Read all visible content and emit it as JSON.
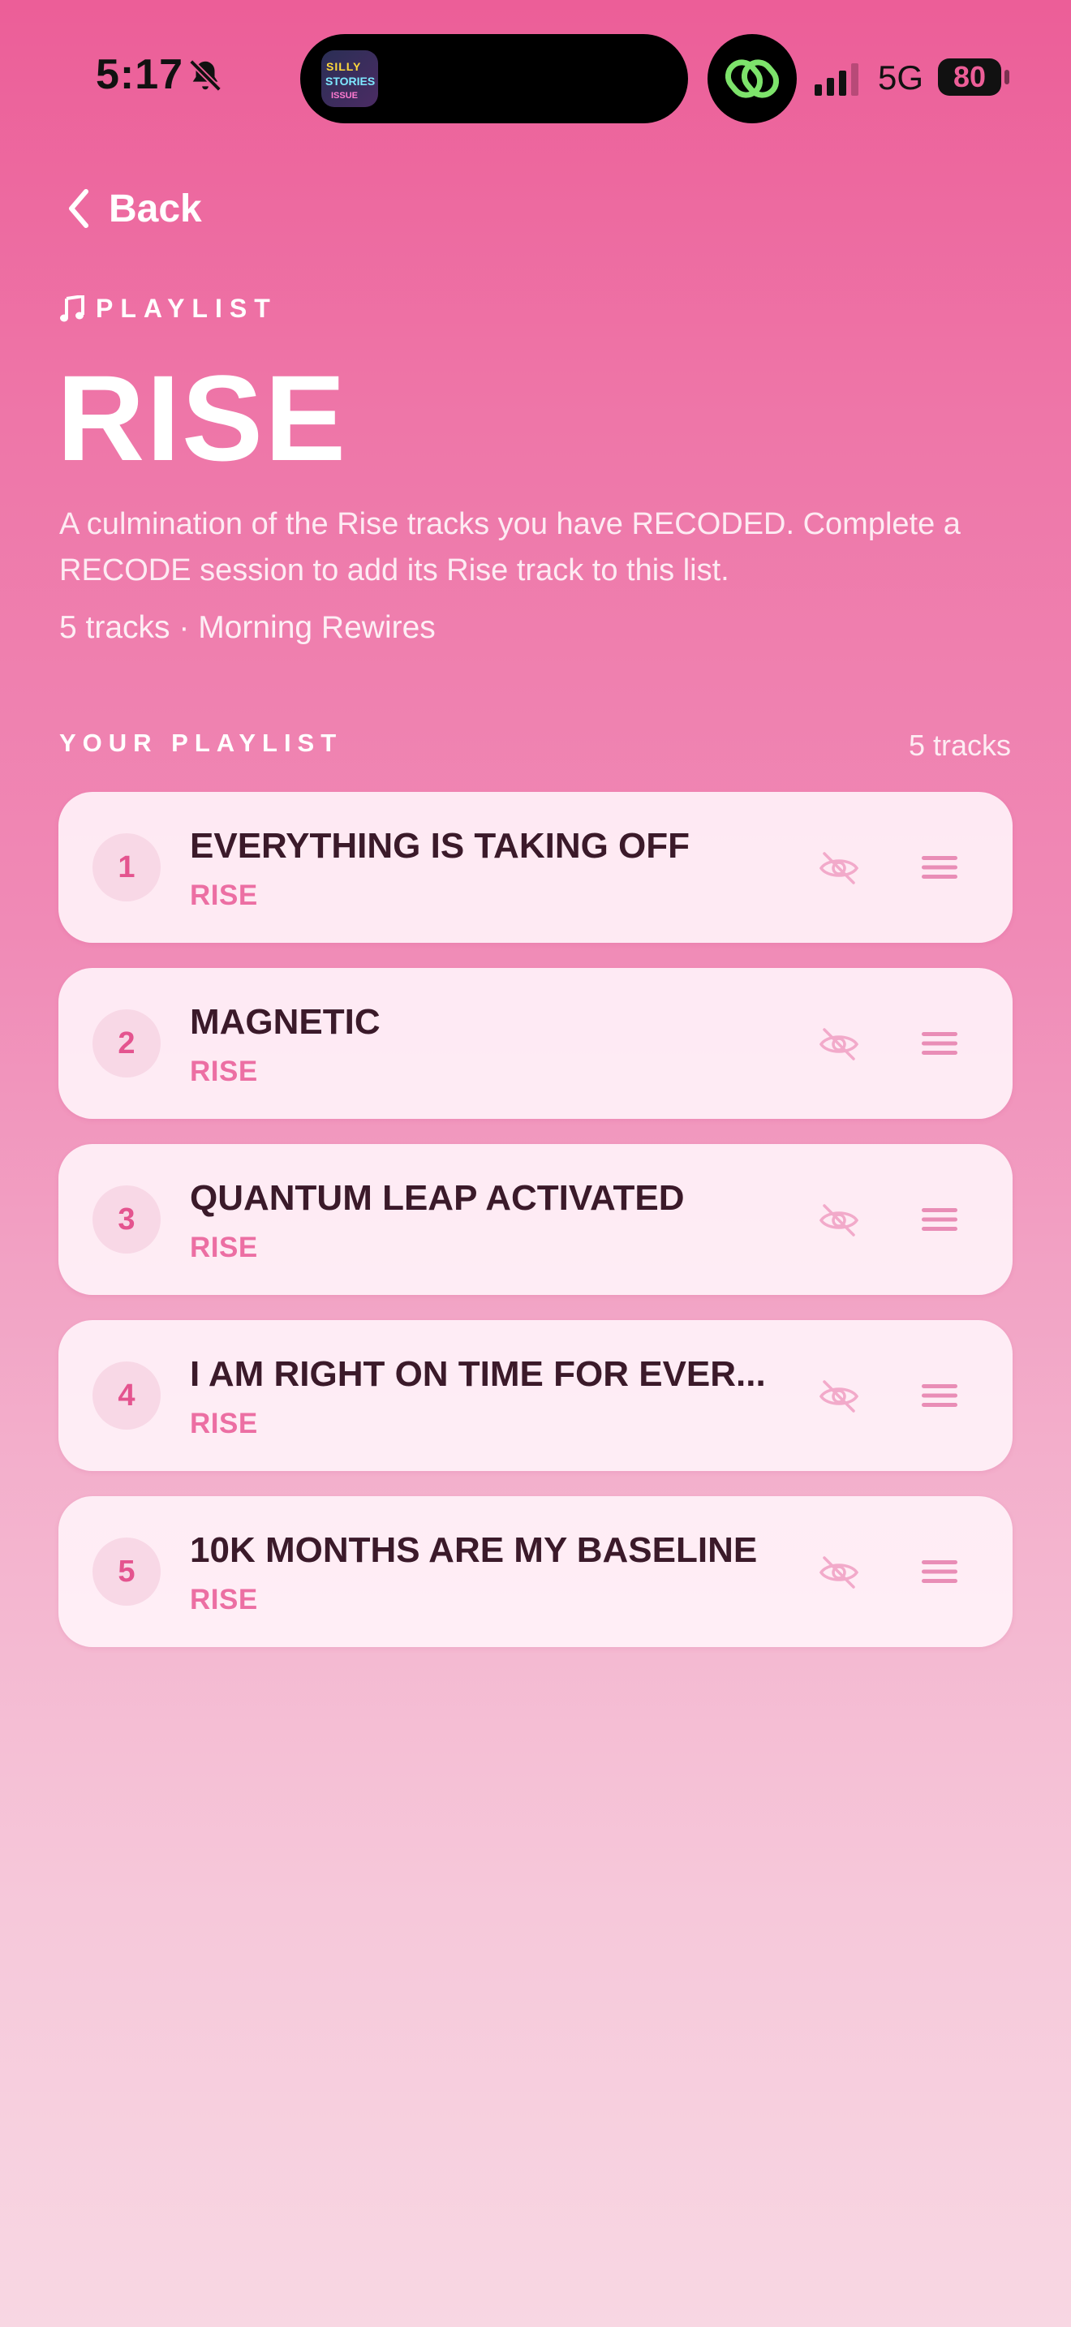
{
  "status_bar": {
    "time": "5:17",
    "network": "5G",
    "battery": "80"
  },
  "island_app": {
    "line1": "SILLY",
    "line2": "STORIES",
    "line3": "ISSUE"
  },
  "header": {
    "back_label": "Back",
    "eyebrow": "PLAYLIST",
    "title": "RISE",
    "description": "A culmination of the Rise tracks you have RECODED. Complete a RECODE session to add its Rise track to this list.",
    "meta": "5 tracks · Morning Rewires"
  },
  "playlist": {
    "section_label": "YOUR PLAYLIST",
    "count_label": "5 tracks",
    "tracks": [
      {
        "number": "1",
        "title": "EVERYTHING IS TAKING OFF",
        "category": "RISE"
      },
      {
        "number": "2",
        "title": "MAGNETIC",
        "category": "RISE"
      },
      {
        "number": "3",
        "title": "QUANTUM LEAP ACTIVATED",
        "category": "RISE"
      },
      {
        "number": "4",
        "title": "I AM RIGHT ON TIME FOR EVER...",
        "category": "RISE"
      },
      {
        "number": "5",
        "title": "10K MONTHS ARE MY BASELINE",
        "category": "RISE"
      }
    ]
  },
  "icons": {
    "back": "chevron-left-icon",
    "eyebrow": "music-note-icon",
    "hide": "eye-off-icon",
    "reorder": "drag-handle-icon",
    "silent": "bell-slash-icon"
  },
  "colors": {
    "accent": "#EC5E98",
    "card": "#FFF2F8",
    "track_title": "#3B1A2A",
    "track_sub": "#EC6FA3"
  }
}
